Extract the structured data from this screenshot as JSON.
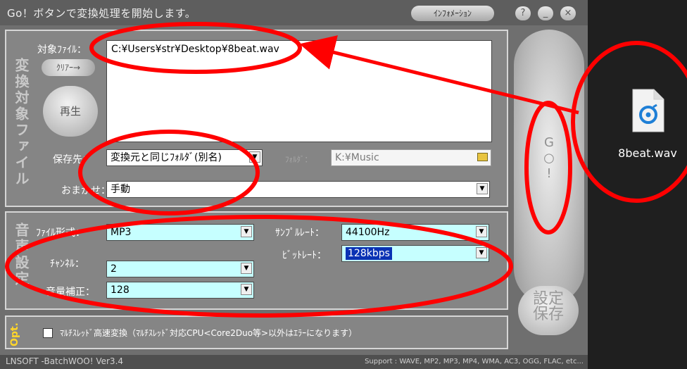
{
  "titlebar": {
    "title": "Go！ボタンで変換処理を開始します。",
    "info_button": "ｲﾝﾌｫﾒｰｼｮﾝ",
    "help": "?",
    "minimize": "_",
    "close": "×"
  },
  "file_panel": {
    "section_label": "変換対象ファイル",
    "target_label": "対象ﾌｧｲﾙ：",
    "clear_button": "ｸﾘｱｰ→",
    "play_button": "再生",
    "file_list": [
      "C:¥Users¥str¥Desktop¥8beat.wav"
    ],
    "save_to_label": "保存先：",
    "save_to_value": "変換元と同じﾌｫﾙﾀﾞ(別名)",
    "folder_label": "ﾌｫﾙﾀﾞ：",
    "folder_value": "K:¥Music",
    "omakase_label": "おまかせ：",
    "omakase_value": "手動"
  },
  "audio_panel": {
    "section_label": "音声設定",
    "format_label": "ﾌｧｲﾙ形式：",
    "format_value": "MP3",
    "channel_label": "ﾁｬﾝﾈﾙ：",
    "channel_value": "2",
    "volume_label": "音量補正：",
    "volume_value": "128",
    "samplerate_label": "ｻﾝﾌﾟﾙﾚｰﾄ：",
    "samplerate_value": "44100Hz",
    "bitrate_label": "ﾋﾞｯﾄﾚｰﾄ：",
    "bitrate_value": "128kbps"
  },
  "opt_panel": {
    "section_label": "Opt.",
    "multithread_label": "ﾏﾙﾁｽﾚｯﾄﾞ高速変換（ﾏﾙﾁｽﾚｯﾄﾞ対応CPU<Core2Duo等>以外はｴﾗｰになります）",
    "multithread_checked": false
  },
  "buttons": {
    "go_label": "G\n○\n!",
    "save_settings_label": "設定\n保存"
  },
  "status": {
    "version": "LNSOFT -BatchWOO! Ver3.4",
    "support": "Support : WAVE, MP2, MP3, MP4, WMA, AC3, OGG, FLAC, etc..."
  },
  "desktop": {
    "file_name": "8beat.wav",
    "icon": "audio-file-icon"
  },
  "colors": {
    "annotation_red": "#ff0000",
    "field_cyan": "#c6ffff",
    "selection_blue": "#0a32b4"
  }
}
